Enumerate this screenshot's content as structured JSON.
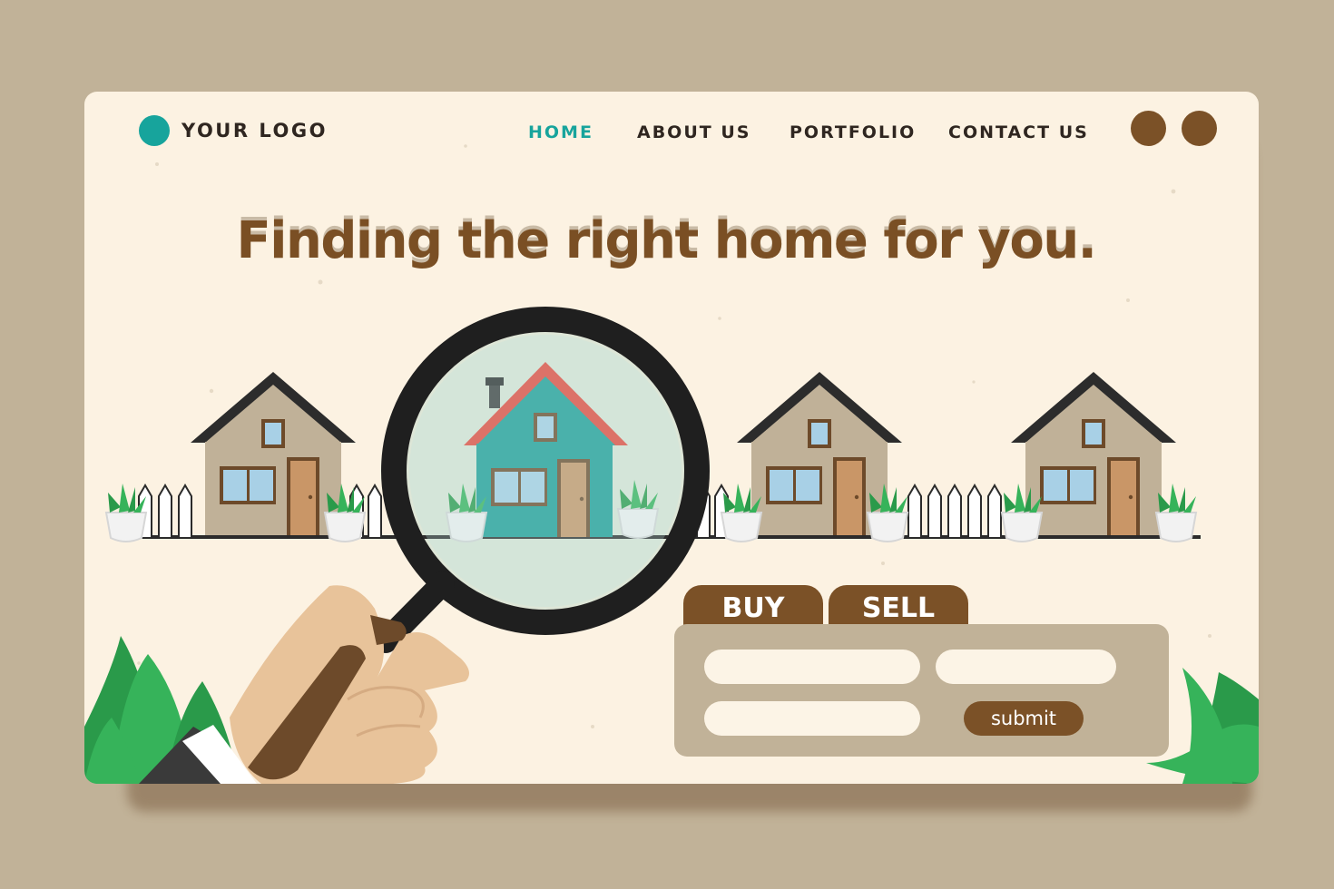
{
  "brand": {
    "logo_text": "YOUR LOGO",
    "logo_color": "#17a49c"
  },
  "nav": {
    "items": [
      {
        "label": "HOME",
        "active": true
      },
      {
        "label": "ABOUT US",
        "active": false
      },
      {
        "label": "PORTFOLIO",
        "active": false
      },
      {
        "label": "CONTACT US",
        "active": false
      }
    ],
    "active_color": "#17a49c"
  },
  "header_buttons": [
    "circle-button",
    "circle-button"
  ],
  "hero": {
    "headline": "Finding the right home for you."
  },
  "search": {
    "tabs": [
      {
        "label": "BUY"
      },
      {
        "label": "SELL"
      }
    ],
    "fields": [
      {
        "value": ""
      },
      {
        "value": ""
      },
      {
        "value": ""
      }
    ],
    "submit_label": "submit"
  },
  "illustration": {
    "houses": 4,
    "highlighted_house": 2,
    "icons": [
      "magnifying-glass-icon",
      "hand-icon",
      "house-icon",
      "potted-plant-icon",
      "fence-icon",
      "leaf-icon"
    ]
  },
  "colors": {
    "brown": "#7b5127",
    "page_background": "#c1b298",
    "card_background": "#fcf2e2",
    "house_teal": "#1e9f98",
    "roof_red": "#e8473b"
  }
}
